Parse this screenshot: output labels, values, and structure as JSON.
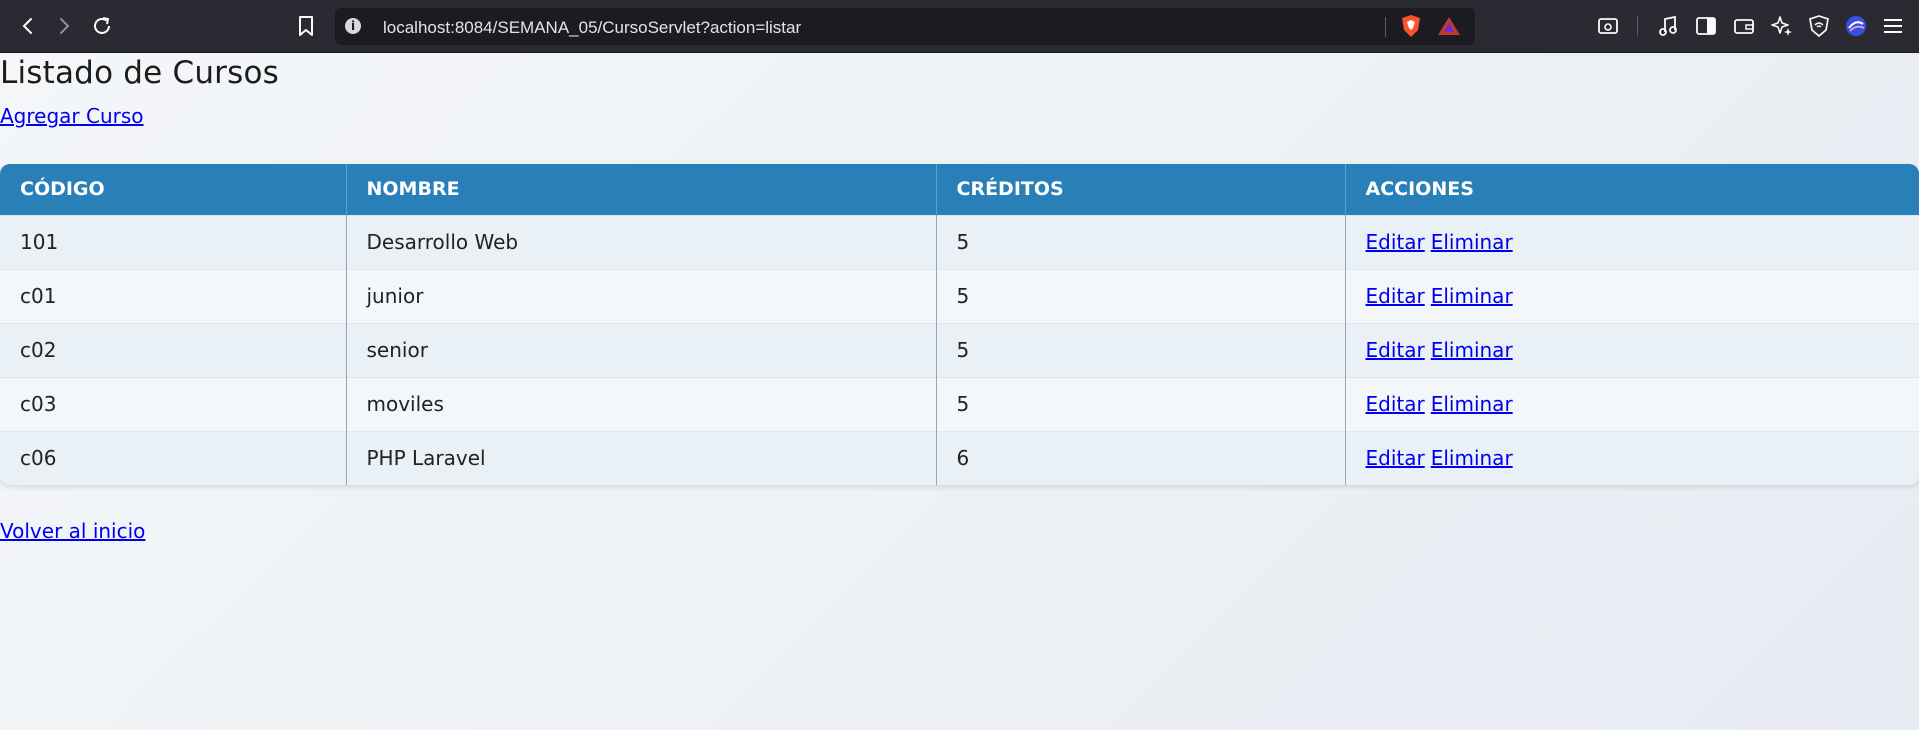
{
  "browser": {
    "url": "localhost:8084/SEMANA_05/CursoServlet?action=listar",
    "toolbar_left_icons": [
      "back-icon",
      "forward-icon",
      "reload-icon",
      "bookmark-icon"
    ],
    "urlbar_right_icons": [
      "brave-shield-icon",
      "brave-rewards-icon"
    ],
    "toolbar_right_icons": [
      "screenshot-icon",
      "media-icon",
      "sidebar-icon",
      "wallet-icon",
      "leo-ai-icon",
      "vpn-icon",
      "profile-icon",
      "menu-icon"
    ]
  },
  "page": {
    "title": "Listado de Cursos",
    "add_link": "Agregar Curso",
    "back_link": "Volver al inicio"
  },
  "table": {
    "headers": [
      "CÓDIGO",
      "NOMBRE",
      "CRÉDITOS",
      "ACCIONES"
    ],
    "edit_label": "Editar",
    "delete_label": "Eliminar",
    "rows": [
      {
        "codigo": "101",
        "nombre": "Desarrollo Web",
        "creditos": "5"
      },
      {
        "codigo": "c01",
        "nombre": "junior",
        "creditos": "5"
      },
      {
        "codigo": "c02",
        "nombre": "senior",
        "creditos": "5"
      },
      {
        "codigo": "c03",
        "nombre": "moviles",
        "creditos": "5"
      },
      {
        "codigo": "c06",
        "nombre": "PHP Laravel",
        "creditos": "6"
      }
    ]
  },
  "colors": {
    "header_bg": "#2980b9",
    "link": "#0000ee",
    "toolbar_bg": "#2b2a33"
  }
}
